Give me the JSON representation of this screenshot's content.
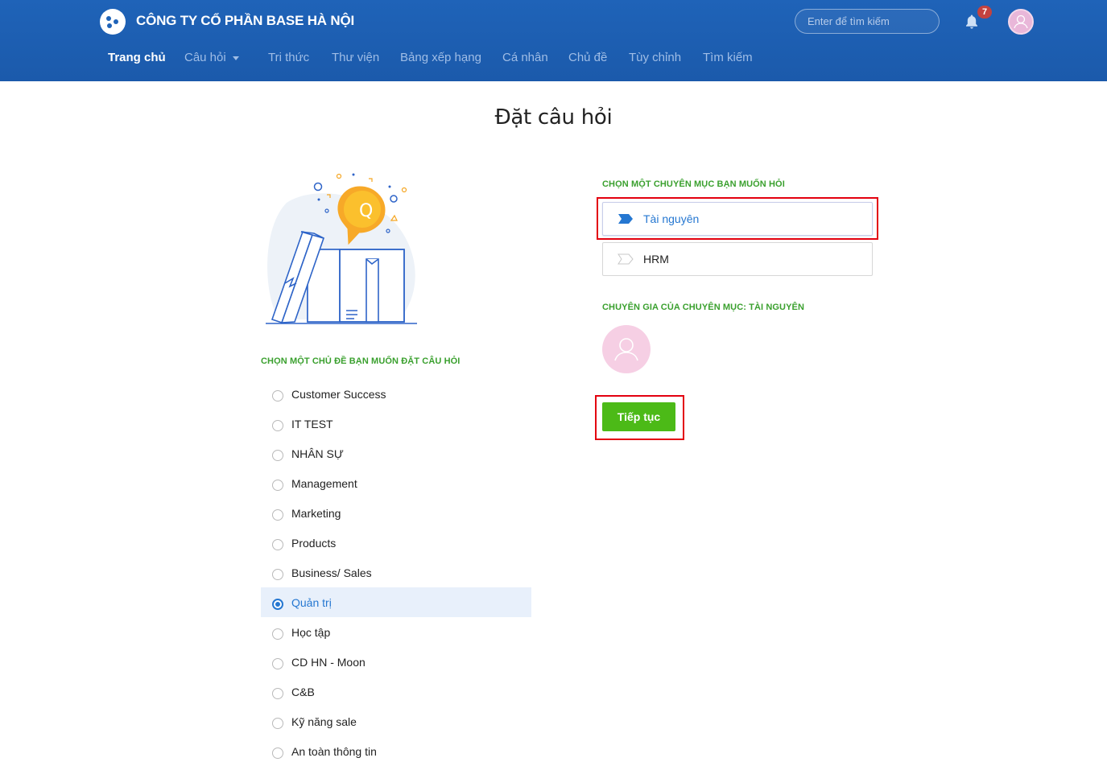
{
  "header": {
    "company_name": "CÔNG TY CỔ PHẦN BASE HÀ NỘI",
    "search_placeholder": "Enter để tìm kiếm",
    "notification_count": "7",
    "nav": [
      {
        "label": "Trang chủ",
        "active": true
      },
      {
        "label": "Câu hỏi",
        "has_dropdown": true
      },
      {
        "label": "Tri thức"
      },
      {
        "label": "Thư viện"
      },
      {
        "label": "Bảng xếp hạng"
      },
      {
        "label": "Cá nhân"
      },
      {
        "label": "Chủ đề"
      },
      {
        "label": "Tùy chỉnh"
      },
      {
        "label": "Tìm kiếm"
      }
    ]
  },
  "page": {
    "title": "Đặt câu hỏi"
  },
  "topics": {
    "label": "CHỌN MỘT CHỦ ĐỀ BẠN MUỐN ĐẶT CÂU HỎI",
    "selected": "Quản trị",
    "items": [
      {
        "label": "Customer Success"
      },
      {
        "label": "IT TEST"
      },
      {
        "label": "NHÂN SỰ"
      },
      {
        "label": "Management"
      },
      {
        "label": "Marketing"
      },
      {
        "label": "Products"
      },
      {
        "label": "Business/ Sales"
      },
      {
        "label": "Quản trị"
      },
      {
        "label": "Học tập"
      },
      {
        "label": "CD HN - Moon"
      },
      {
        "label": "C&B"
      },
      {
        "label": "Kỹ năng sale"
      },
      {
        "label": "An toàn thông tin"
      }
    ]
  },
  "categories": {
    "label": "CHỌN MỘT CHUYÊN MỤC BẠN MUỐN HỎI",
    "selected": "Tài nguyên",
    "items": [
      {
        "label": "Tài nguyên"
      },
      {
        "label": "HRM"
      }
    ]
  },
  "experts": {
    "label": "CHUYÊN GIA CỦA CHUYÊN MỤC: TÀI NGUYÊN"
  },
  "actions": {
    "continue_label": "Tiếp tục"
  },
  "colors": {
    "header_blue": "#1f63b8",
    "accent_blue": "#2577d1",
    "green_label": "#3aa02e",
    "continue_green": "#4cba17",
    "highlight_red": "#e3000f"
  },
  "icons": {
    "logo": "base-logo-icon",
    "notification": "bell-icon",
    "category_selected": "tag-filled-icon",
    "category": "tag-outline-icon",
    "avatar": "user-icon"
  }
}
